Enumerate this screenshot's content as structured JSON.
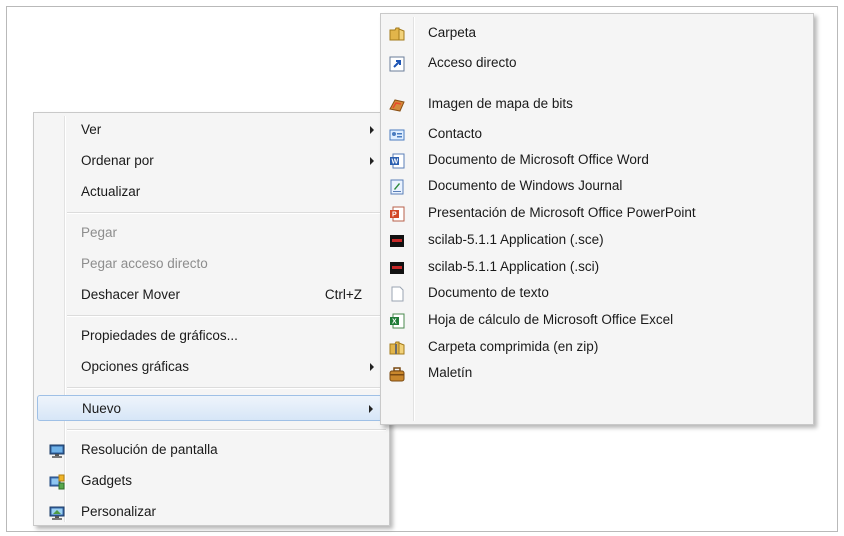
{
  "context_menu": {
    "items": [
      {
        "label": "Ver",
        "submenu": true
      },
      {
        "label": "Ordenar por",
        "submenu": true
      },
      {
        "label": "Actualizar"
      },
      {
        "label": "Pegar",
        "disabled": true
      },
      {
        "label": "Pegar acceso directo",
        "disabled": true
      },
      {
        "label": "Deshacer Mover",
        "shortcut": "Ctrl+Z"
      },
      {
        "label": "Propiedades de gráficos..."
      },
      {
        "label": "Opciones gráficas",
        "submenu": true
      },
      {
        "label": "Nuevo",
        "submenu": true,
        "highlighted": true
      },
      {
        "label": "Resolución de pantalla",
        "icon": "screen-resolution-icon"
      },
      {
        "label": "Gadgets",
        "icon": "gadgets-icon"
      },
      {
        "label": "Personalizar",
        "icon": "personalize-icon"
      }
    ]
  },
  "submenu": {
    "items": [
      {
        "label": "Carpeta",
        "icon": "folder-icon"
      },
      {
        "label": "Acceso directo",
        "icon": "shortcut-icon"
      },
      {
        "label": "Imagen de mapa de bits",
        "icon": "bitmap-image-icon"
      },
      {
        "label": "Contacto",
        "icon": "contact-icon"
      },
      {
        "label": "Documento de Microsoft Office Word",
        "icon": "word-document-icon"
      },
      {
        "label": "Documento de Windows Journal",
        "icon": "journal-document-icon"
      },
      {
        "label": "Presentación de Microsoft Office PowerPoint",
        "icon": "powerpoint-icon"
      },
      {
        "label": "scilab-5.1.1 Application (.sce)",
        "icon": "scilab-sce-icon"
      },
      {
        "label": "scilab-5.1.1 Application (.sci)",
        "icon": "scilab-sci-icon"
      },
      {
        "label": "Documento de texto",
        "icon": "text-document-icon"
      },
      {
        "label": "Hoja de cálculo de Microsoft Office Excel",
        "icon": "excel-icon"
      },
      {
        "label": "Carpeta comprimida (en zip)",
        "icon": "zip-folder-icon"
      },
      {
        "label": "Maletín",
        "icon": "briefcase-icon"
      }
    ]
  },
  "colors": {
    "menu_background": "#f5f5f5",
    "highlight_border": "#9fc0e6",
    "disabled_text": "#8d8d8d"
  }
}
